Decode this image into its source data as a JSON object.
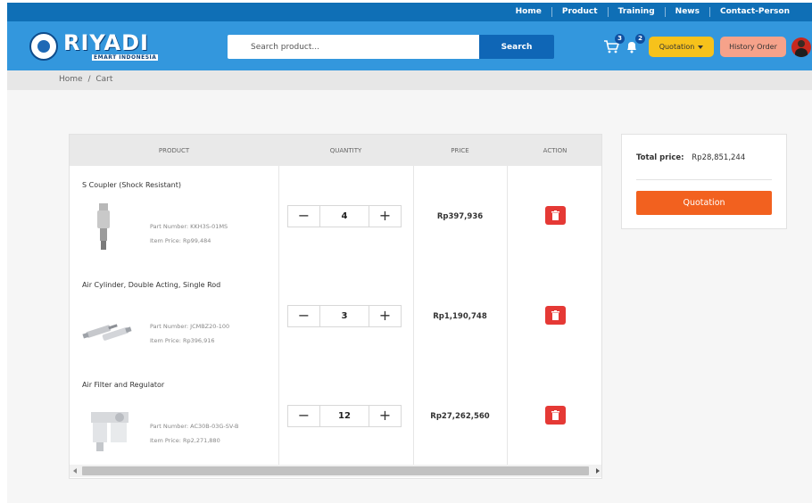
{
  "nav": {
    "links": [
      "Home",
      "Product",
      "Training",
      "News",
      "Contact-Person"
    ]
  },
  "header": {
    "brand": "RIYADI",
    "brand_sub": "EMART INDONESIA",
    "search_placeholder": "Search product...",
    "search_button": "Search",
    "cart_count": "3",
    "notif_count": "2",
    "quotation_label": "Quotation",
    "history_label": "History Order"
  },
  "breadcrumb": {
    "home": "Home",
    "sep": "/",
    "current": "Cart"
  },
  "table": {
    "headers": {
      "product": "PRODUCT",
      "quantity": "QUANTITY",
      "price": "PRICE",
      "action": "ACTION"
    },
    "rows": [
      {
        "name": "S Coupler (Shock Resistant)",
        "part_number": "Part Number: KKH3S-01MS",
        "item_price": "Item Price: Rp99,484",
        "qty": "4",
        "price": "Rp397,936"
      },
      {
        "name": "Air Cylinder, Double Acting, Single Rod",
        "part_number": "Part Number: JCMBZ20-100",
        "item_price": "Item Price: Rp396,916",
        "qty": "3",
        "price": "Rp1,190,748"
      },
      {
        "name": "Air Filter and Regulator",
        "part_number": "Part Number: AC30B-03G-SV-B",
        "item_price": "Item Price: Rp2,271,880",
        "qty": "12",
        "price": "Rp27,262,560"
      }
    ]
  },
  "summary": {
    "total_label": "Total price:",
    "total_value": "Rp28,851,244",
    "quotation_button": "Quotation"
  },
  "colors": {
    "nav": "#0f6fb6",
    "header": "#3397dd",
    "quotation_yellow": "#f7c21b",
    "history_peach": "#f6a28a",
    "delete_red": "#e53935",
    "quotation_orange": "#f2611f"
  }
}
